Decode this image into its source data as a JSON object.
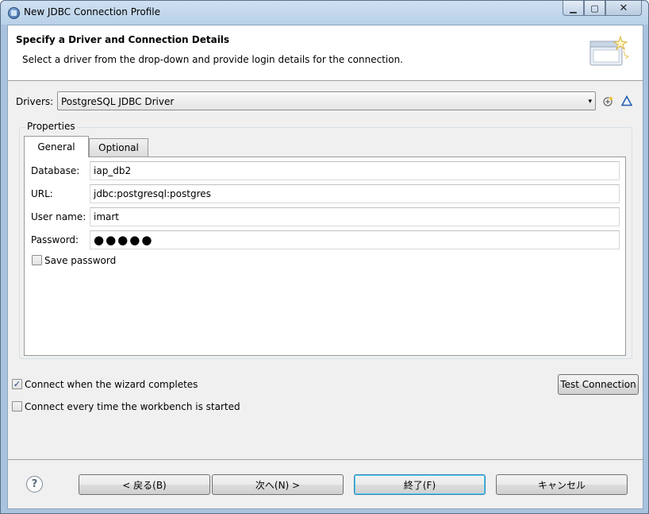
{
  "window": {
    "title": "New JDBC Connection Profile"
  },
  "header": {
    "title": "Specify a Driver and Connection Details",
    "description": "Select a driver from the drop-down and provide login details for the connection."
  },
  "drivers": {
    "label": "Drivers:",
    "selected": "PostgreSQL JDBC Driver"
  },
  "properties": {
    "label": "Properties",
    "tabs": [
      "General",
      "Optional"
    ],
    "fields": {
      "database": {
        "label": "Database:",
        "value": "iap_db2"
      },
      "url": {
        "label": "URL:",
        "value": "jdbc:postgresql:postgres"
      },
      "username": {
        "label": "User name:",
        "value": "imart"
      },
      "password": {
        "label": "Password:",
        "value": "●●●●●"
      }
    },
    "save_password": {
      "label": "Save password",
      "checked": false
    }
  },
  "options": {
    "connect_when_completes": {
      "label": "Connect when the wizard completes",
      "checked": true
    },
    "connect_every_time": {
      "label": "Connect every time the workbench is started",
      "checked": false
    }
  },
  "test_connection_label": "Test Connection",
  "footer": {
    "back_label": "< 戻る(B)",
    "next_label": "次へ(N) >",
    "finish_label": "終了(F)",
    "cancel_label": "キャンセル",
    "help_glyph": "?"
  },
  "glyphs": {
    "check": "✓",
    "combo_arrow": "▾",
    "minimize": "▁",
    "maximize": "▢",
    "close": "✕"
  }
}
